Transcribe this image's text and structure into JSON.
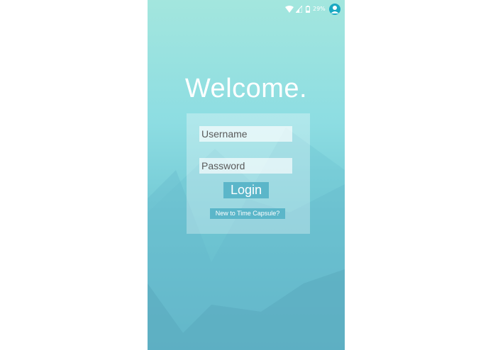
{
  "status_bar": {
    "battery_percent": "29%",
    "icons": [
      "wifi-icon",
      "signal-icon",
      "battery-icon",
      "account-icon"
    ]
  },
  "welcome": {
    "title": "Welcome."
  },
  "login_form": {
    "username_placeholder": "Username",
    "username_value": "",
    "password_placeholder": "Password",
    "password_value": "",
    "login_label": "Login",
    "signup_label": "New to Time Capsule?"
  },
  "colors": {
    "background_top": "#a3e6de",
    "background_bottom": "#5fb0c4",
    "button": "#5bb6c9",
    "avatar": "#1aa9c2",
    "text": "#ffffff"
  }
}
